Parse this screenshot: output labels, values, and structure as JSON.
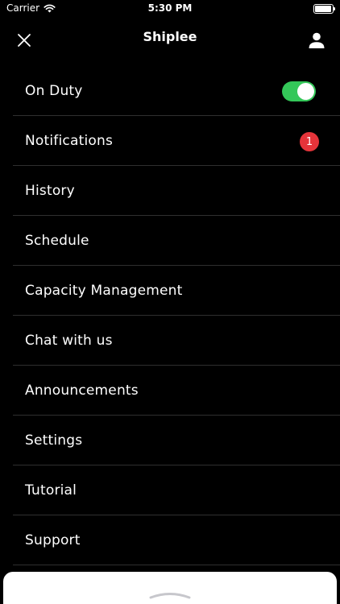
{
  "status_bar": {
    "carrier": "Carrier",
    "time": "5:30 PM",
    "battery_level": 0.95,
    "icons": [
      "wifi-icon",
      "battery-icon"
    ]
  },
  "nav": {
    "title": "Shiplee",
    "left_icon": "close-icon",
    "right_icon": "profile-icon"
  },
  "menu": {
    "items": [
      {
        "label": "On Duty",
        "toggle_on": true
      },
      {
        "label": "Notifications",
        "badge": "1"
      },
      {
        "label": "History"
      },
      {
        "label": "Schedule"
      },
      {
        "label": "Capacity Management"
      },
      {
        "label": "Chat with us"
      },
      {
        "label": "Announcements"
      },
      {
        "label": "Settings"
      },
      {
        "label": "Tutorial"
      },
      {
        "label": "Support"
      }
    ]
  },
  "colors": {
    "background": "#000000",
    "toggle_on": "#34c759",
    "badge": "#e5343a",
    "divider": "#2f2f2f",
    "sheet": "#ffffff"
  }
}
